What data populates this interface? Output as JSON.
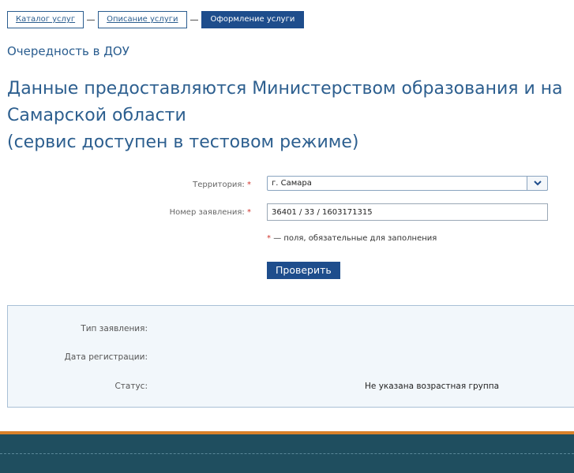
{
  "breadcrumb": {
    "items": [
      "Каталог услуг",
      "Описание услуги"
    ],
    "active": "Оформление услуги"
  },
  "service_name": "Очередность в ДОУ",
  "headline": {
    "line1": "Данные предоставляются Министерством образования и на",
    "line2": "Самарской области",
    "line3": "(сервис доступен в тестовом режиме)"
  },
  "form": {
    "territory_label": "Территория:",
    "territory_value": "г. Самара",
    "application_label": "Номер заявления:",
    "application_value": "36401 / 33 / 1603171315",
    "required_mark": "*",
    "required_hint": "— поля, обязательные для заполнения",
    "submit_label": "Проверить"
  },
  "results": {
    "type_label": "Тип заявления:",
    "type_value": "",
    "date_label": "Дата регистрации:",
    "date_value": "",
    "status_label": "Статус:",
    "status_value": "Не указана возрастная группа"
  },
  "colors": {
    "accent": "#1e4d8c",
    "footer_bg": "#1f4e5f",
    "footer_stripe": "#d9822b"
  }
}
